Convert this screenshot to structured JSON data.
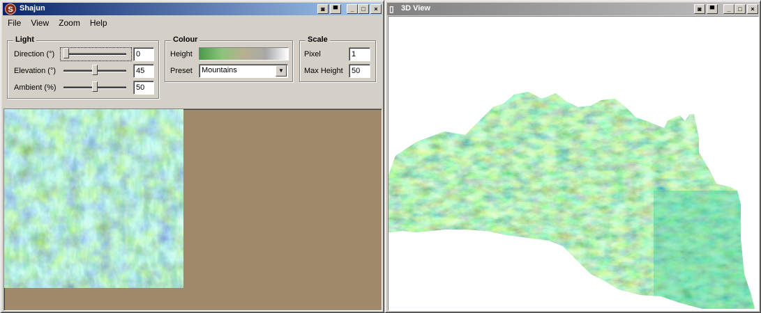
{
  "window_main": {
    "title": "Shajun",
    "icon": "app-logo-icon",
    "menu": [
      "File",
      "View",
      "Zoom",
      "Help"
    ],
    "light": {
      "title": "Light",
      "direction": {
        "label": "Direction (°)",
        "value": "0",
        "slider_fraction": 0.0
      },
      "elevation": {
        "label": "Elevation (°)",
        "value": "45",
        "slider_fraction": 0.5
      },
      "ambient": {
        "label": "Ambient (%)",
        "value": "50",
        "slider_fraction": 0.5
      }
    },
    "colour": {
      "title": "Colour",
      "height_label": "Height",
      "gradient_colors": [
        "#4a9a4a",
        "#8bc47a",
        "#b8b090",
        "#a8a8a8",
        "#ffffff"
      ],
      "preset_label": "Preset",
      "preset_value": "Mountains"
    },
    "scale": {
      "title": "Scale",
      "pixel_label": "Pixel",
      "pixel_value": "1",
      "max_height_label": "Max Height",
      "max_height_value": "50"
    },
    "map_background": "#a08a69"
  },
  "window_3d": {
    "title": "3D View",
    "icon": "document-icon"
  },
  "title_buttons": {
    "extra1": "◙",
    "extra2": "▀",
    "minimize": "_",
    "maximize": "□",
    "close": "×"
  }
}
